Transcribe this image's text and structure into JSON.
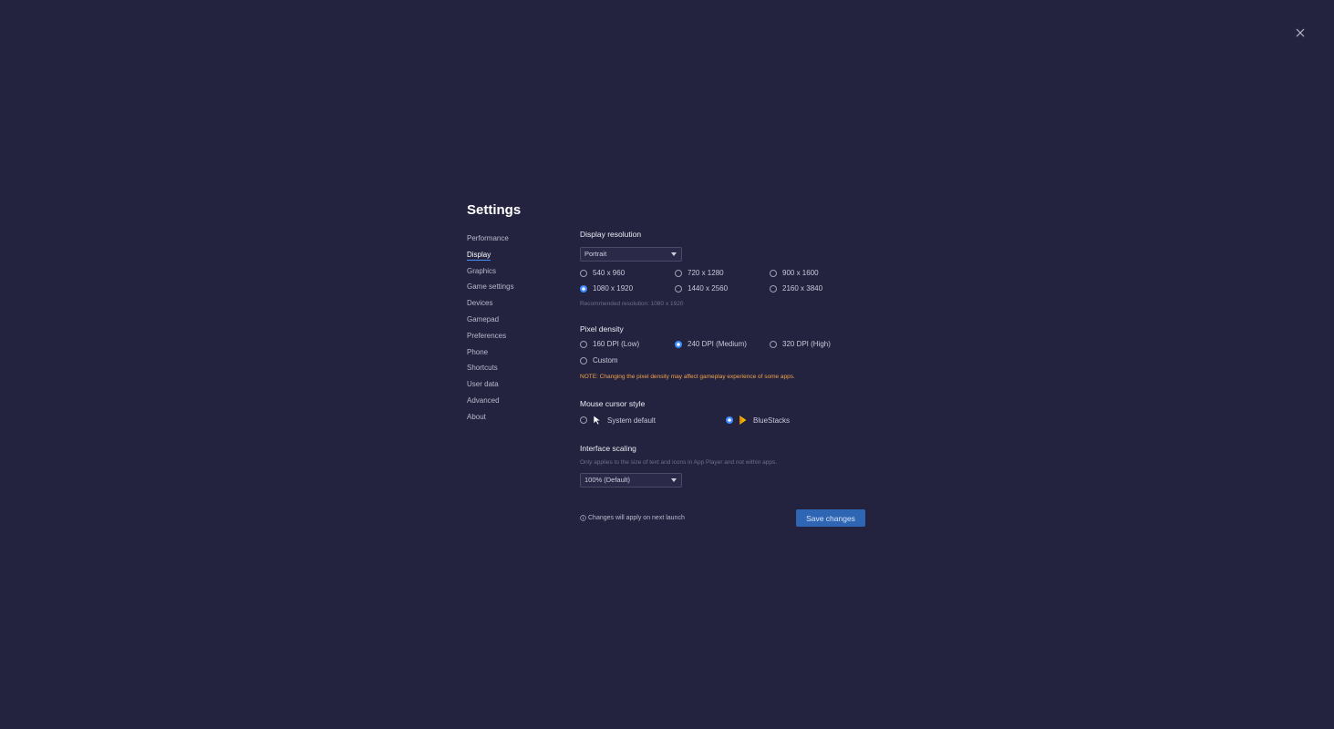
{
  "settings_title": "Settings",
  "nav": {
    "items": [
      {
        "label": "Performance",
        "active": false
      },
      {
        "label": "Display",
        "active": true
      },
      {
        "label": "Graphics",
        "active": false
      },
      {
        "label": "Game settings",
        "active": false
      },
      {
        "label": "Devices",
        "active": false
      },
      {
        "label": "Gamepad",
        "active": false
      },
      {
        "label": "Preferences",
        "active": false
      },
      {
        "label": "Phone",
        "active": false
      },
      {
        "label": "Shortcuts",
        "active": false
      },
      {
        "label": "User data",
        "active": false
      },
      {
        "label": "Advanced",
        "active": false
      },
      {
        "label": "About",
        "active": false
      }
    ]
  },
  "display_resolution": {
    "title": "Display resolution",
    "orientation_selected": "Portrait",
    "options": [
      "540 x 960",
      "720 x 1280",
      "900 x 1600",
      "1080 x 1920",
      "1440 x 2560",
      "2160 x 3840"
    ],
    "selected": "1080 x 1920",
    "recommended": "Recommended resolution: 1080 x 1920"
  },
  "pixel_density": {
    "title": "Pixel density",
    "options": [
      "160 DPI (Low)",
      "240 DPI (Medium)",
      "320 DPI (High)",
      "Custom"
    ],
    "selected": "240 DPI (Medium)",
    "note": "NOTE: Changing the pixel density may affect gameplay experience of some apps."
  },
  "mouse_cursor": {
    "title": "Mouse cursor style",
    "options": [
      "System default",
      "BlueStacks"
    ],
    "selected": "BlueStacks"
  },
  "interface_scaling": {
    "title": "Interface scaling",
    "hint": "Only applies to the size of text and icons in App Player and not within apps.",
    "selected": "100% (Default)"
  },
  "footer": {
    "info": "Changes will apply on next launch",
    "save_label": "Save changes"
  },
  "colors": {
    "background": "#24233f",
    "accent": "#3d8bff",
    "save_button": "#2f66b4",
    "note": "#f0a14a"
  }
}
